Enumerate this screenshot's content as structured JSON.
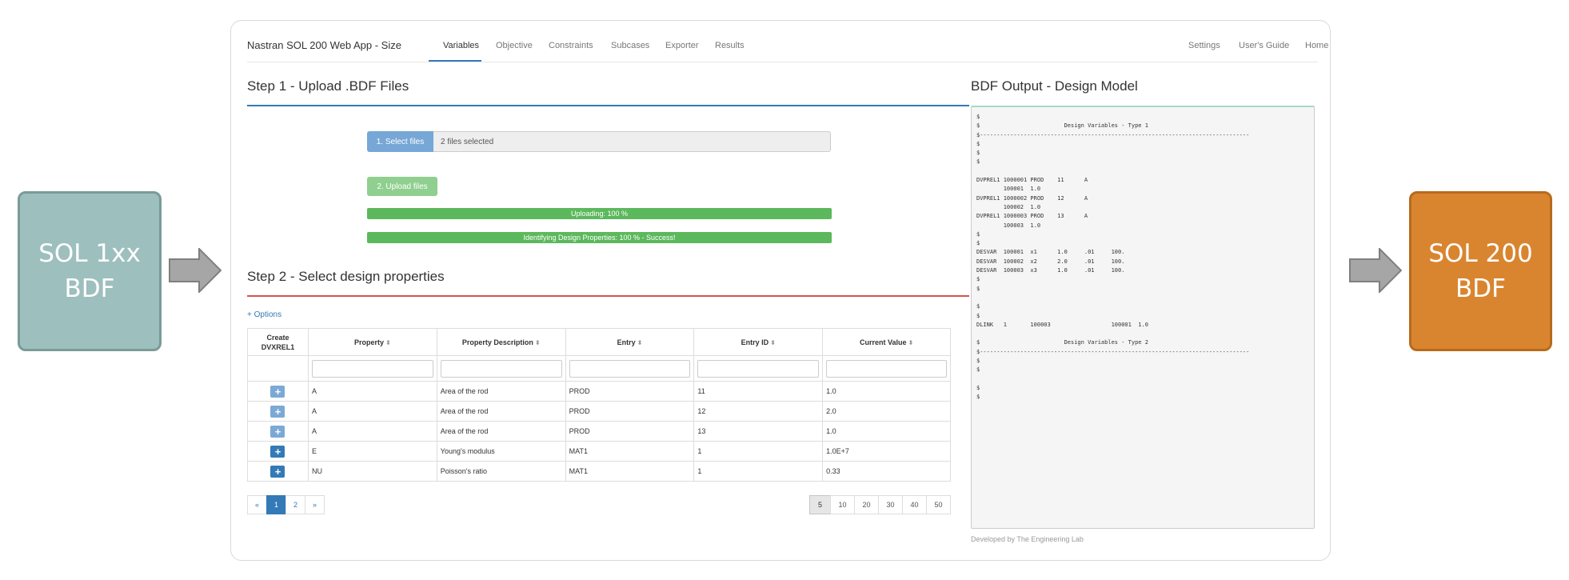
{
  "left_box": {
    "line1": "SOL 1xx",
    "line2": "BDF"
  },
  "right_box": {
    "line1": "SOL 200",
    "line2": "BDF"
  },
  "colors": {
    "left_box": "#9dbfbd",
    "right_box": "#d98530",
    "arrow": "#a6a6a6",
    "primary": "#337ab7",
    "success": "#5cb85c",
    "step1_rule": "#337ab7",
    "step2_rule": "#d9534f"
  },
  "navbar": {
    "brand": "Nastran SOL 200 Web App - Size",
    "tabs": [
      "Variables",
      "Objective",
      "Constraints",
      "Subcases",
      "Exporter",
      "Results"
    ],
    "active_tab": "Variables",
    "right_links": [
      "Settings",
      "User's Guide",
      "Home"
    ]
  },
  "step1": {
    "title": "Step 1 - Upload .BDF Files",
    "select_button": "1. Select files",
    "files_status": "2 files selected",
    "upload_button": "2. Upload files",
    "progress": [
      {
        "label": "Uploading: 100 %",
        "value": 100
      },
      {
        "label": "Identifying Design Properties: 100 % - Success!",
        "value": 100
      }
    ]
  },
  "step2": {
    "title": "Step 2 - Select design properties",
    "options_link": "+ Options",
    "columns": [
      "Create DVXREL1",
      "Property",
      "Property Description",
      "Entry",
      "Entry ID",
      "Current Value"
    ],
    "rows": [
      {
        "property": "A",
        "description": "Area of the rod",
        "entry": "PROD",
        "entry_id": "11",
        "value": "1.0",
        "light": true
      },
      {
        "property": "A",
        "description": "Area of the rod",
        "entry": "PROD",
        "entry_id": "12",
        "value": "2.0",
        "light": true
      },
      {
        "property": "A",
        "description": "Area of the rod",
        "entry": "PROD",
        "entry_id": "13",
        "value": "1.0",
        "light": true
      },
      {
        "property": "E",
        "description": "Young's modulus",
        "entry": "MAT1",
        "entry_id": "1",
        "value": "1.0E+7",
        "light": false
      },
      {
        "property": "NU",
        "description": "Poisson's ratio",
        "entry": "MAT1",
        "entry_id": "1",
        "value": "0.33",
        "light": false
      }
    ],
    "pagination": {
      "prev": "«",
      "pages": [
        "1",
        "2"
      ],
      "next": "»",
      "current": "1"
    },
    "page_sizes": [
      "5",
      "10",
      "20",
      "30",
      "40",
      "50"
    ],
    "current_page_size": "5"
  },
  "bdf_output": {
    "title": "BDF Output - Design Model",
    "text": "$\n$                         Design Variables - Type 1\n$--------------------------------------------------------------------------------\n$\n$\n$\n\nDVPREL1 1000001 PROD    11      A\n        100001  1.0\nDVPREL1 1000002 PROD    12      A\n        100002  1.0\nDVPREL1 1000003 PROD    13      A\n        100003  1.0\n$\n$\nDESVAR  100001  x1      1.0     .01     100.\nDESVAR  100002  x2      2.0     .01     100.\nDESVAR  100003  x3      1.0     .01     100.\n$\n$\n\n$\n$\nDLINK   1       100003                  100001  1.0\n\n$                         Design Variables - Type 2\n$--------------------------------------------------------------------------------\n$\n$\n\n$\n$"
  },
  "footer": "Developed by The Engineering Lab"
}
